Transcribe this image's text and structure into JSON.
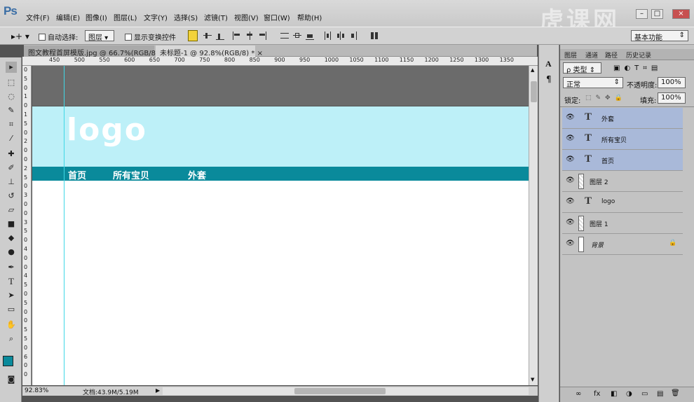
{
  "app": {
    "logo": "Ps"
  },
  "menu": [
    "文件(F)",
    "编辑(E)",
    "图像(I)",
    "图层(L)",
    "文字(Y)",
    "选择(S)",
    "滤镜(T)",
    "视图(V)",
    "窗口(W)",
    "帮助(H)"
  ],
  "window_controls": {
    "minimize": "–",
    "maximize": "□",
    "close": "×"
  },
  "watermark": "虎课网",
  "options": {
    "auto_select_label": "自动选择:",
    "auto_select_value": "图层",
    "show_transform_label": "显示变换控件",
    "workspace_value": "基本功能"
  },
  "tabs": [
    {
      "label": "图文教程首屏模版.jpg @ 66.7%(RGB/8)",
      "close": "×"
    },
    {
      "label": "未标题-1 @ 92.8%(RGB/8) *",
      "close": "×"
    }
  ],
  "ruler_top": [
    "450",
    "500",
    "550",
    "600",
    "650",
    "700",
    "750",
    "800",
    "850",
    "900",
    "950",
    "1000",
    "1050",
    "1100",
    "1150",
    "1200",
    "1250",
    "1300",
    "1350"
  ],
  "ruler_left": [
    "0",
    "5",
    "0",
    "1",
    "0",
    "1",
    "5",
    "0",
    "2",
    "0",
    "0",
    "2",
    "5",
    "0",
    "3",
    "0",
    "0",
    "3",
    "5",
    "0",
    "4",
    "0",
    "0",
    "4",
    "5",
    "0",
    "5",
    "0",
    "0",
    "5",
    "5",
    "0",
    "6",
    "0",
    "0"
  ],
  "canvas": {
    "logo": "logo",
    "nav": [
      "首页",
      "所有宝贝",
      "外套"
    ],
    "colors": {
      "header": "#bdf0f8",
      "nav": "#0a8a9b",
      "dark": "#6b6b6b"
    }
  },
  "status": {
    "zoom": "92.83%",
    "doc": "文档:43.9M/5.19M"
  },
  "layers_panel": {
    "tabs": [
      "图层",
      "通道",
      "路径",
      "历史记录"
    ],
    "kind_value": "ρ 类型",
    "blend_value": "正常",
    "opacity_label": "不透明度:",
    "opacity_value": "100%",
    "lock_label": "锁定:",
    "fill_label": "填充:",
    "fill_value": "100%",
    "layers": [
      {
        "name": "外套",
        "type": "text",
        "selected": true
      },
      {
        "name": "所有宝贝",
        "type": "text",
        "selected": true
      },
      {
        "name": "首页",
        "type": "text",
        "selected": true
      },
      {
        "name": "图层 2",
        "type": "pixel",
        "selected": false
      },
      {
        "name": "logo",
        "type": "text",
        "selected": false
      },
      {
        "name": "图层 1",
        "type": "pixel",
        "selected": false
      },
      {
        "name": "背景",
        "type": "background",
        "selected": false
      }
    ],
    "bottom_icons": [
      "∞",
      "fx",
      "◧",
      "◑",
      "▭",
      "▤",
      "🗑"
    ]
  }
}
